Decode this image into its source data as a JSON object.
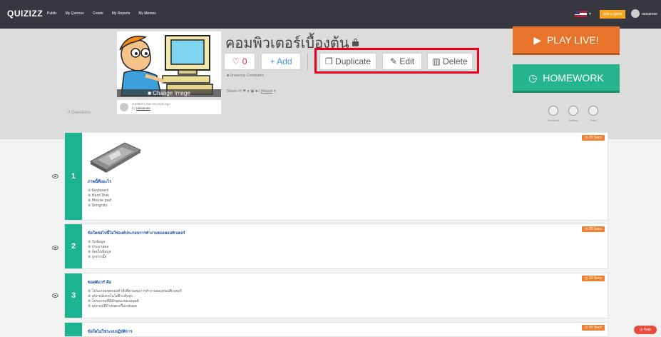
{
  "nav": {
    "logo": "QUIZIZZ",
    "links": [
      "Public",
      "My Quizzes",
      "Create",
      "My Reports",
      "My Memes"
    ],
    "join_label": "Join a game",
    "username": "rassamee"
  },
  "quiz": {
    "title": "คอมพิวเตอร์เบื้องต้น",
    "change_image_label": "Change Image",
    "likes": "0",
    "add_label": "+ Add",
    "duplicate_label": "Duplicate",
    "edit_label": "Edit",
    "delete_label": "Delete",
    "tags": "University  Computers",
    "share_label": "Share",
    "report_label": "Report",
    "created_text": "created a few seconds ago",
    "by_prefix": "by",
    "creator": "rassamee",
    "question_count": "4 Questions"
  },
  "actions": {
    "play_live": "PLAY LIVE!",
    "homework": "HOMEWORK",
    "modes": [
      "Slideshow",
      "Preview",
      "Print"
    ]
  },
  "questions": [
    {
      "num": "1",
      "time": "30 Secs",
      "text": "ภาพนี้คืออะไร",
      "options": [
        "Keyboard",
        "Hard Disk",
        "Mouse pad",
        "Simgrsts"
      ]
    },
    {
      "num": "2",
      "time": "30 Secs",
      "text": "ข้อใดต่อไปนี้ไม่ใช่องค์ประกอบการทำงานของคอมพิวเตอร์",
      "options": [
        "รับข้อมูล",
        "ประมวลผล",
        "จัดเก็บข้อมูล",
        "ถูกกรรมั้ล"
      ]
    },
    {
      "num": "3",
      "time": "30 Secs",
      "text": "ซอฟต์แวร์ คือ",
      "options": [
        "โปรแกรมชุดของคำสั่งที่ควบคุมการทำงานของคอมพิวเตอร์",
        "อุปกรณ์เทคโนโลยีระดับสูง",
        "โปรแกรมที่มีลักษณะของมนุษย์",
        "อุปกรณ์ที่กำหนดเครื่องเล่นผล"
      ]
    },
    {
      "num": "4",
      "time": "30 Secs",
      "text": "ข้อใดไม่ใช่ระบบปฏิบัติการ",
      "options": []
    }
  ],
  "help_label": "Help",
  "colors": {
    "nav": "#37373f",
    "play": "#e8742b",
    "homework": "#27b58e",
    "qnum": "#1cb391",
    "highlight": "#e8001c"
  }
}
